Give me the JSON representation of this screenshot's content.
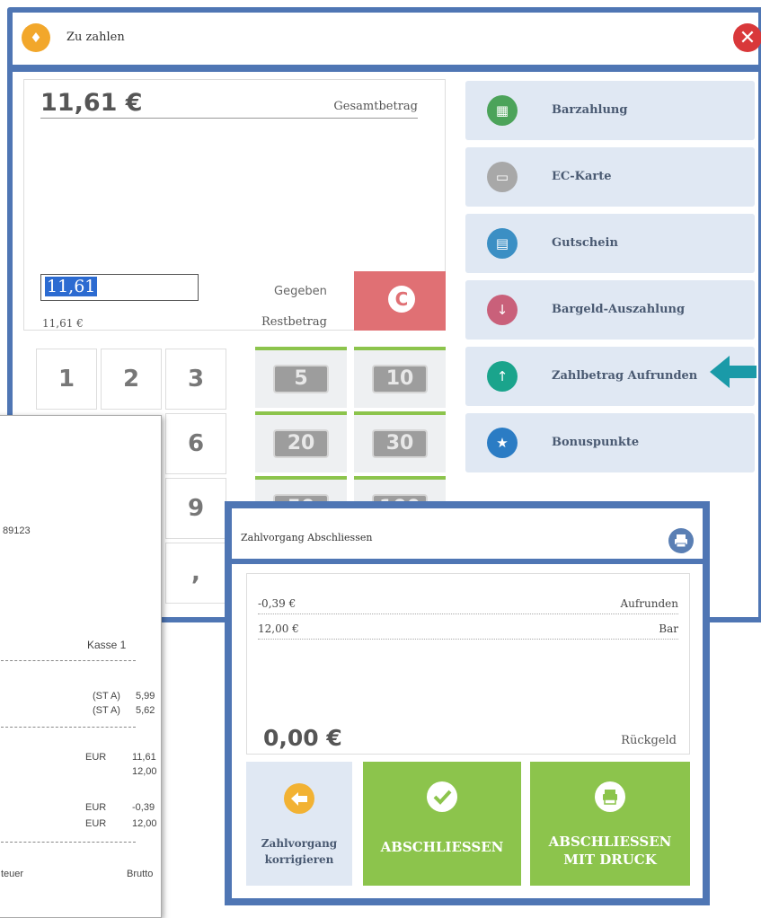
{
  "payment_window": {
    "title": "Zu zahlen",
    "total_amount": "11,61 €",
    "total_label": "Gesamtbetrag",
    "given_value": "11,61",
    "given_label": "Gegeben",
    "remaining_value": "11,61 €",
    "remaining_label": "Restbetrag",
    "clear_label": "C",
    "keypad": [
      "1",
      "2",
      "3",
      "6",
      "9",
      ","
    ],
    "notes": [
      "5",
      "10",
      "20",
      "30",
      "50",
      "100"
    ],
    "methods": [
      {
        "label": "Barzahlung",
        "icon": "cash-register-icon",
        "color": "#4ca35a"
      },
      {
        "label": "EC-Karte",
        "icon": "card-icon",
        "color": "#a8a8a8"
      },
      {
        "label": "Gutschein",
        "icon": "voucher-icon",
        "color": "#3b8fc4"
      },
      {
        "label": "Bargeld-Auszahlung",
        "icon": "cash-withdrawal-icon",
        "color": "#c9607a"
      },
      {
        "label": "Zahlbetrag Aufrunden",
        "icon": "round-up-icon",
        "color": "#1aa48c"
      },
      {
        "label": "Bonuspunkte",
        "icon": "bonus-points-icon",
        "color": "#2b7cc4"
      }
    ]
  },
  "receipt": {
    "partial_id": "89123",
    "register": "Kasse 1",
    "items": [
      {
        "tax": "(ST A)",
        "amount": "5,99"
      },
      {
        "tax": "(ST A)",
        "amount": "5,62"
      }
    ],
    "lines": [
      {
        "currency": "EUR",
        "amount": "11,61"
      },
      {
        "currency": "",
        "amount": "12,00"
      },
      {
        "currency": "EUR",
        "amount": "-0,39"
      },
      {
        "currency": "EUR",
        "amount": "12,00"
      }
    ],
    "footer_left": "teuer",
    "footer_right": "Brutto"
  },
  "dialog": {
    "title": "Zahlvorgang Abschliessen",
    "lines": [
      {
        "amount": "-0,39 €",
        "label": "Aufrunden"
      },
      {
        "amount": "12,00 €",
        "label": "Bar"
      }
    ],
    "change_amount": "0,00 €",
    "change_label": "Rückgeld",
    "correct_label_1": "Zahlvorgang",
    "correct_label_2": "korrigieren",
    "finish_label": "ABSCHLIESSEN",
    "finish_print_label_1": "ABSCHLIESSEN",
    "finish_print_label_2": "MIT DRUCK"
  },
  "colors": {
    "window_frame": "#4f76b4",
    "method_bg": "#e0e8f3",
    "clear_red": "#e07074",
    "action_green": "#8cc44c",
    "arrow_teal": "#1a9aa8"
  }
}
